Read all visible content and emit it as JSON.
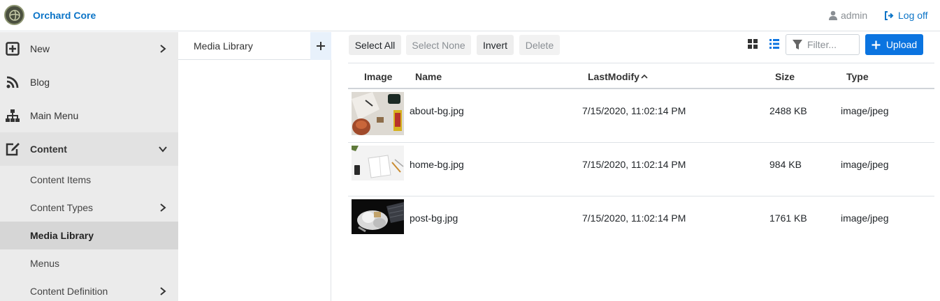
{
  "brand": {
    "name": "Orchard Core"
  },
  "user": {
    "name": "admin",
    "logoff_label": "Log off"
  },
  "sidebar": {
    "items": [
      {
        "label": "New",
        "icon": "plus-square-icon"
      },
      {
        "label": "Blog",
        "icon": "rss-icon"
      },
      {
        "label": "Main Menu",
        "icon": "sitemap-icon"
      },
      {
        "label": "Content",
        "icon": "edit-icon"
      }
    ],
    "subitems": [
      {
        "label": "Content Items"
      },
      {
        "label": "Content Types"
      },
      {
        "label": "Media Library"
      },
      {
        "label": "Menus"
      },
      {
        "label": "Content Definition"
      }
    ]
  },
  "folders": {
    "title": "Media Library"
  },
  "toolbar": {
    "select_all": "Select All",
    "select_none": "Select None",
    "invert": "Invert",
    "delete": "Delete",
    "filter_placeholder": "Filter...",
    "upload": "Upload"
  },
  "table": {
    "headers": {
      "image": "Image",
      "name": "Name",
      "modified": "LastModify",
      "size": "Size",
      "type": "Type"
    },
    "rows": [
      {
        "name": "about-bg.jpg",
        "modified": "7/15/2020, 11:02:14 PM",
        "size": "2488 KB",
        "type": "image/jpeg"
      },
      {
        "name": "home-bg.jpg",
        "modified": "7/15/2020, 11:02:14 PM",
        "size": "984 KB",
        "type": "image/jpeg"
      },
      {
        "name": "post-bg.jpg",
        "modified": "7/15/2020, 11:02:14 PM",
        "size": "1761 KB",
        "type": "image/jpeg"
      }
    ]
  },
  "colors": {
    "accent": "#0b74e0",
    "brand": "#0b74c7",
    "sidebar_bg": "#ebebeb",
    "active_bg": "#d6d6d6"
  }
}
